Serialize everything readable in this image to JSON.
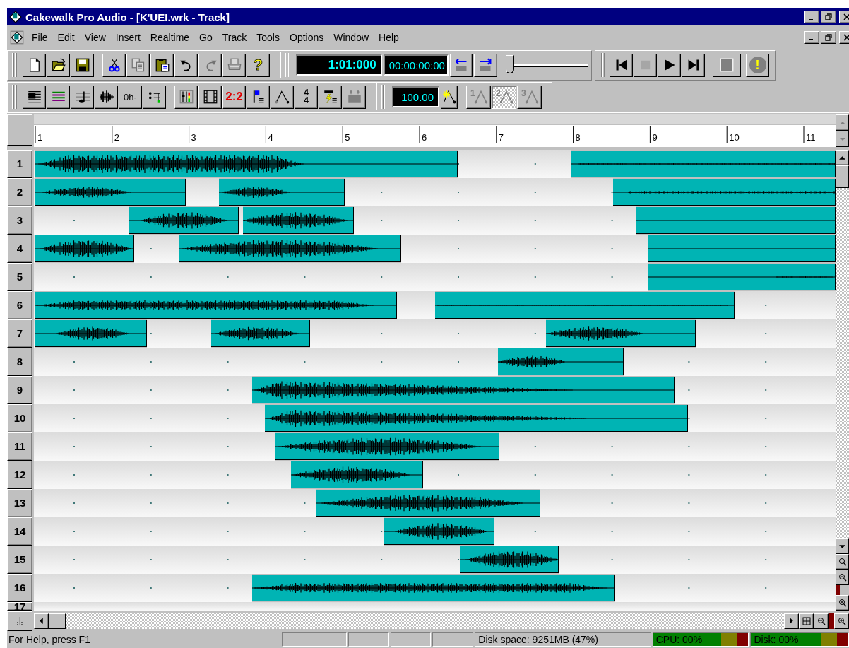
{
  "window": {
    "title": "Cakewalk Pro Audio - [K'UEI.wrk - Track]"
  },
  "menu": [
    "File",
    "Edit",
    "View",
    "Insert",
    "Realtime",
    "Go",
    "Track",
    "Tools",
    "Options",
    "Window",
    "Help"
  ],
  "file_toolbar": [
    {
      "kind": "new",
      "disabled": false
    },
    {
      "kind": "open",
      "disabled": false
    },
    {
      "kind": "save",
      "disabled": false
    }
  ],
  "edit_toolbar": [
    {
      "kind": "cut",
      "disabled": false
    },
    {
      "kind": "copy",
      "disabled": true
    },
    {
      "kind": "paste",
      "disabled": false
    },
    {
      "kind": "undo",
      "disabled": false
    },
    {
      "kind": "redo",
      "disabled": true
    },
    {
      "kind": "print",
      "disabled": true
    },
    {
      "kind": "help",
      "label": "?",
      "disabled": false
    }
  ],
  "time_display": {
    "measure": "1:01:000",
    "smpte": "00:00:00:00"
  },
  "now_slider": {
    "level": 0
  },
  "transport": [
    {
      "kind": "rewind",
      "disabled": false
    },
    {
      "kind": "stop",
      "disabled": true
    },
    {
      "kind": "play",
      "disabled": false
    },
    {
      "kind": "end",
      "disabled": false
    },
    {
      "kind": "record",
      "disabled": false
    },
    {
      "kind": "panic",
      "label": "!",
      "disabled": false
    }
  ],
  "views_toolbar": [
    {
      "kind": "track"
    },
    {
      "kind": "event-list"
    },
    {
      "kind": "staff"
    },
    {
      "kind": "audio"
    },
    {
      "kind": "text",
      "label": "0h-"
    },
    {
      "kind": "list"
    }
  ],
  "windows_toolbar": [
    {
      "kind": "console"
    },
    {
      "kind": "video"
    },
    {
      "kind": "red-text",
      "label": "2:2"
    },
    {
      "kind": "markers"
    },
    {
      "kind": "tempo"
    },
    {
      "kind": "meter",
      "label": "4",
      "sub": "4"
    },
    {
      "kind": "sysx"
    },
    {
      "kind": "lyrics"
    }
  ],
  "tempo": {
    "value": "100.00"
  },
  "punch": [
    {
      "label": "1",
      "selected": false
    },
    {
      "label": "2",
      "selected": true
    },
    {
      "label": "3",
      "selected": false
    }
  ],
  "ruler": [
    "1",
    "2",
    "3",
    "4",
    "5",
    "6",
    "7",
    "8",
    "9",
    "10",
    "11"
  ],
  "tracks": [
    {
      "number": "1"
    },
    {
      "number": "2"
    },
    {
      "number": "3"
    },
    {
      "number": "4"
    },
    {
      "number": "5"
    },
    {
      "number": "6"
    },
    {
      "number": "7"
    },
    {
      "number": "8"
    },
    {
      "number": "9"
    },
    {
      "number": "10"
    },
    {
      "number": "11"
    },
    {
      "number": "12"
    },
    {
      "number": "13"
    },
    {
      "number": "14"
    },
    {
      "number": "15"
    },
    {
      "number": "16"
    },
    {
      "number": "17"
    }
  ],
  "status_bar": {
    "help": "For Help, press F1",
    "disk_space": "Disk space: 9251MB (47%)",
    "cpu": "CPU: 00%",
    "disk": "Disk: 00%"
  }
}
